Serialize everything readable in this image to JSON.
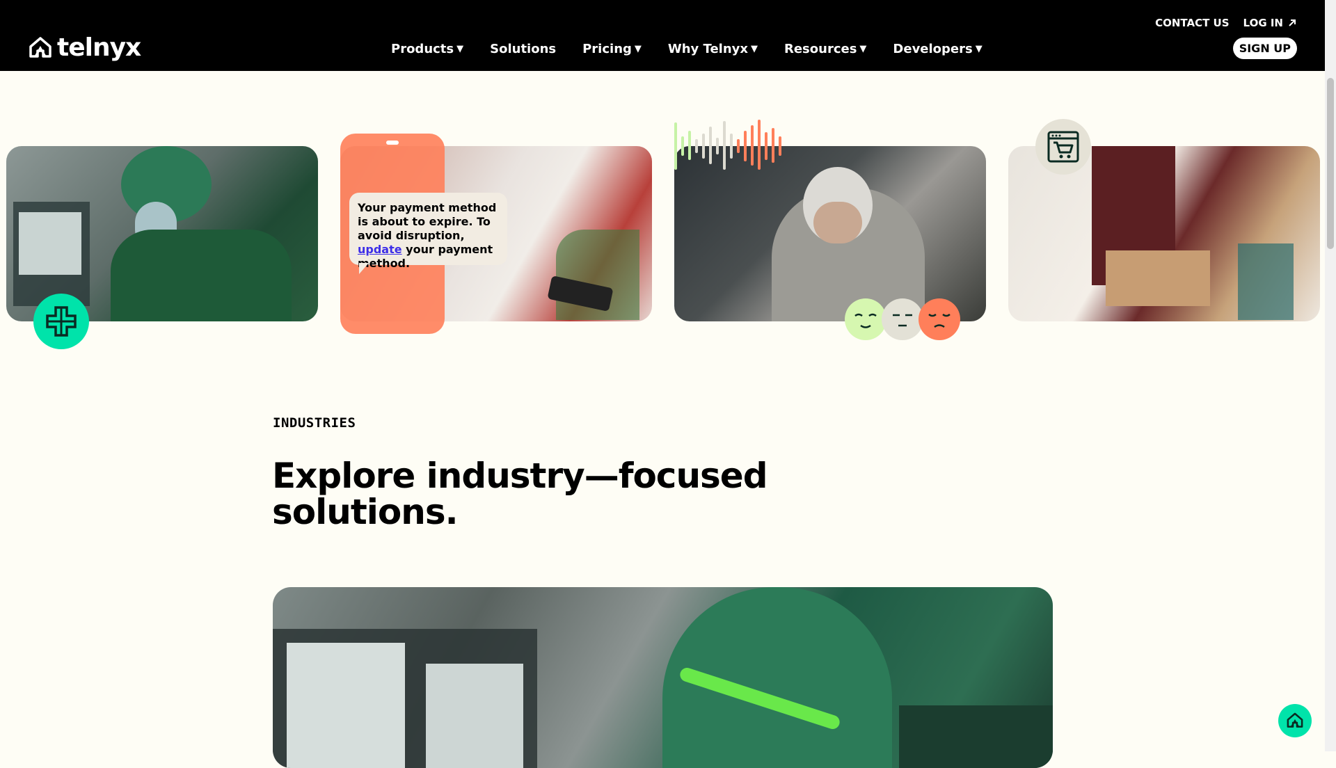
{
  "header": {
    "brand": "telnyx",
    "top_links": {
      "contact": "CONTACT US",
      "login": "LOG IN"
    },
    "signup": "SIGN UP",
    "nav": [
      {
        "label": "Products",
        "has_caret": true
      },
      {
        "label": "Solutions",
        "has_caret": false
      },
      {
        "label": "Pricing",
        "has_caret": true
      },
      {
        "label": "Why Telnyx",
        "has_caret": true
      },
      {
        "label": "Resources",
        "has_caret": true
      },
      {
        "label": "Developers",
        "has_caret": true
      }
    ],
    "caret": "▼"
  },
  "cards": {
    "healthcare": {
      "icon": "medical-cross-icon"
    },
    "retail_sms": {
      "message_prefix": "Your payment method is about to expire. To avoid disruption, ",
      "message_link": "update",
      "message_suffix": " your payment method."
    },
    "voice": {
      "icons": [
        "sound-wave-icon",
        "happy-face-icon",
        "neutral-face-icon",
        "sad-face-icon"
      ]
    },
    "ecommerce": {
      "icon": "shopping-cart-icon"
    }
  },
  "section": {
    "eyebrow": "INDUSTRIES",
    "headline": "Explore industry—focused solutions."
  },
  "colors": {
    "header_bg": "#000000",
    "page_bg": "#fefdf5",
    "accent_green": "#00e3aa",
    "accent_orange": "#ff7f5a",
    "link_blue": "#3d2ee8"
  },
  "chat_widget": {
    "icon": "telnyx-logo-icon"
  }
}
